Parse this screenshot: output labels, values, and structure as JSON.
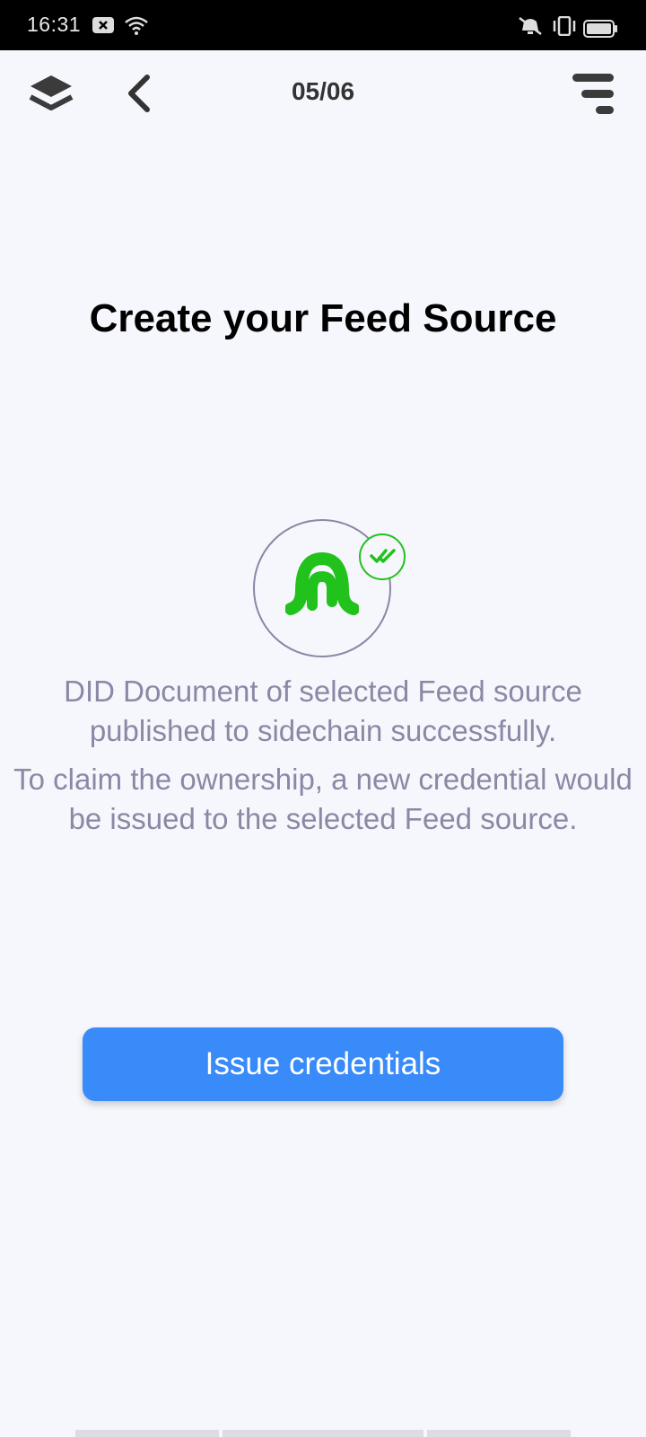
{
  "status_bar": {
    "time": "16:31",
    "icons": [
      "notification-x-icon",
      "wifi-icon",
      "mute-icon",
      "vibrate-icon",
      "battery-icon"
    ]
  },
  "app_bar": {
    "page_indicator": "05/06",
    "left_icons": [
      "layers-icon",
      "back-chevron-icon"
    ],
    "right_icons": [
      "menu-icon"
    ]
  },
  "main": {
    "title": "Create your Feed Source",
    "logo_color": "#22c21c",
    "message_1": "DID Document of selected Feed source published to sidechain successfully.",
    "message_2": "To claim the ownership, a new credential would be issued to the selected Feed source.",
    "primary_button_label": "Issue credentials",
    "primary_button_color": "#398bfa"
  }
}
